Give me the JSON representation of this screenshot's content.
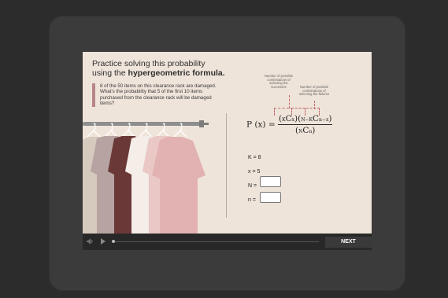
{
  "slide": {
    "title_line1": "Practice solving this probability",
    "title_line2_prefix": "using the ",
    "title_line2_bold": "hypergeometric formula.",
    "problem": "8 of the 50 items on this clearance rack are damaged. What's the probability that 5 of the first 10 items purchased from the clearance rack will be damaged items?",
    "formula": {
      "lhs": "P (x) =",
      "c1_pre": "K",
      "c1_base": "C",
      "c1_post": "x",
      "c2_pre": "N−K",
      "c2_base": "C",
      "c2_post": "n−x",
      "den_pre": "N",
      "den_base": "C",
      "den_post": "n"
    },
    "note_successes": "Number of possible combinations of selecting the successes",
    "note_failures": "Number of possible combinations of selecting the failures",
    "vars": {
      "K": "K = 8",
      "x": "x = 5",
      "N": "N =",
      "n": "n ="
    }
  },
  "controls": {
    "volume_icon": "volume-icon",
    "play_icon": "play-icon",
    "next_label": "NEXT"
  }
}
